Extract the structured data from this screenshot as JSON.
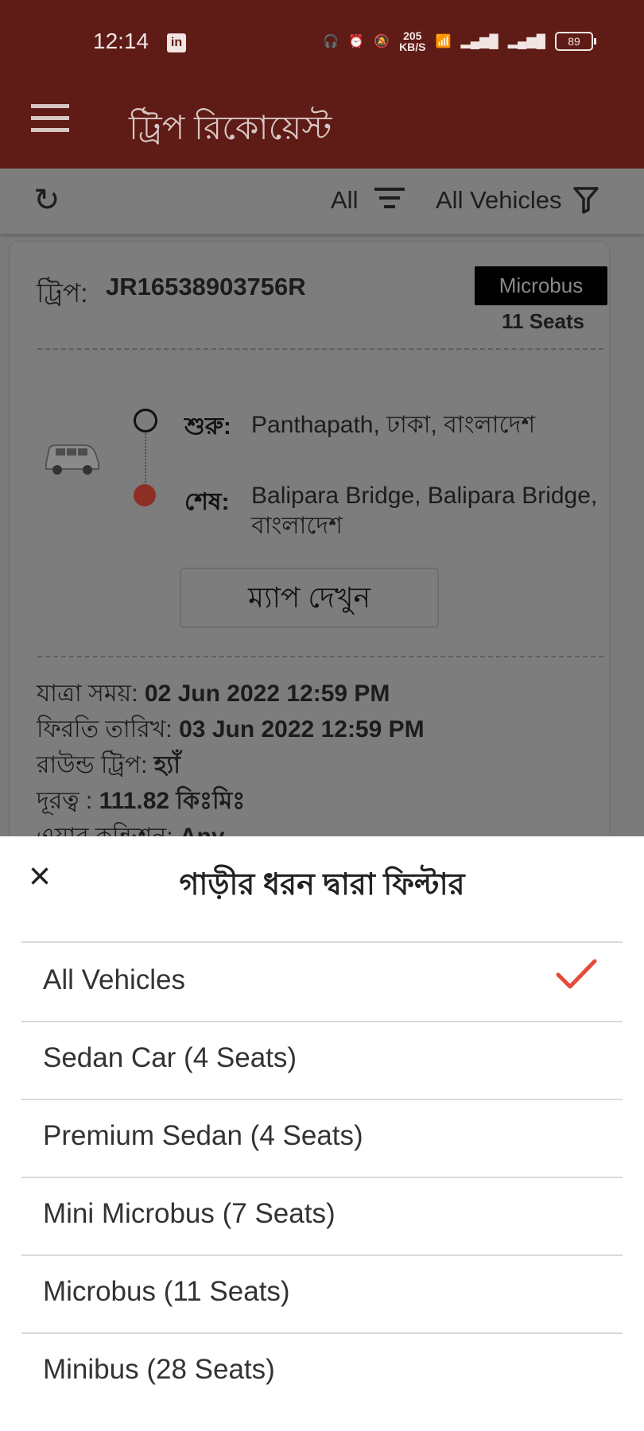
{
  "status_bar": {
    "time": "12:14",
    "linkedin_label": "in",
    "speed_top": "205",
    "speed_unit": "KB/S",
    "battery": "89"
  },
  "app_bar": {
    "title": "ট্রিপ রিকোয়েস্ট"
  },
  "toolbar": {
    "all_label": "All",
    "vehicle_filter_label": "All Vehicles"
  },
  "trip": {
    "label": "ট্রিপ:",
    "id": "JR16538903756R",
    "vehicle_type": "Microbus",
    "seats": "11 Seats",
    "start_label": "শুরু:",
    "start_location": "Panthapath, ঢাকা, বাংলাদেশ",
    "end_label": "শেষ:",
    "end_location": "Balipara Bridge, Balipara Bridge, বাংলাদেশ",
    "map_button": "ম্যাপ দেখুন",
    "details": {
      "travel_time_label": "যাত্রা সময়:",
      "travel_time": "02 Jun 2022 12:59 PM",
      "return_date_label": "ফিরতি তারিখ:",
      "return_date": "03 Jun 2022 12:59 PM",
      "round_trip_label": "রাউন্ড ট্রিপ:",
      "round_trip": "হ্যাঁ",
      "distance_label": "দূরত্ব :",
      "distance": "111.82 কিঃমিঃ",
      "ac_label": "এয়ার কন্ডিশন:",
      "ac": "Any"
    }
  },
  "bottom_sheet": {
    "title": "গাড়ীর ধরন দ্বারা ফিল্টার",
    "options": [
      {
        "label": "All Vehicles",
        "selected": true
      },
      {
        "label": "Sedan Car (4 Seats)",
        "selected": false
      },
      {
        "label": "Premium Sedan (4 Seats)",
        "selected": false
      },
      {
        "label": "Mini Microbus (7 Seats)",
        "selected": false
      },
      {
        "label": "Microbus (11 Seats)",
        "selected": false
      },
      {
        "label": "Minibus (28 Seats)",
        "selected": false
      }
    ]
  },
  "colors": {
    "app_bar": "#5f1b15",
    "dimmed_background": "#7d7d7d",
    "check": "#e64b3c"
  },
  "icons": [
    "linkedin-icon",
    "headphones-icon",
    "alarm-icon",
    "mute-icon",
    "wifi-icon",
    "signal-icon",
    "battery-icon",
    "menu-icon",
    "refresh-icon",
    "sort-lines-icon",
    "funnel-icon",
    "microbus-icon",
    "close-icon",
    "check-icon"
  ]
}
